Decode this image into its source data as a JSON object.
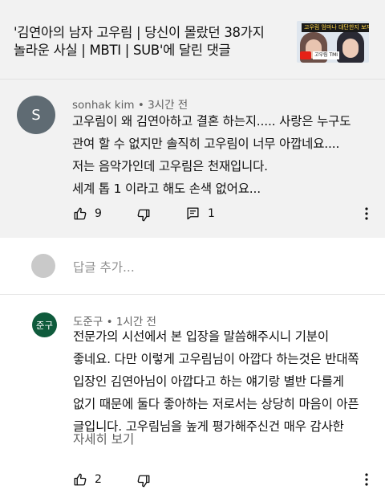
{
  "video": {
    "title_line1": "'김연아의 남자 고우림 | 당신이 몰랐던 38가지",
    "title_line2": "놀라운 사실 | MBTI | SUB'에 달린 댓글",
    "thumbnail": {
      "banner_text": "고우림 엄마나 대단한지 보자",
      "tag_text": "고우림 TMI"
    }
  },
  "comments": [
    {
      "avatar_letter": "S",
      "author": "sonhak kim",
      "separator": "•",
      "time": "3시간 전",
      "lines": [
        "고우림이 왜 김연아하고 결혼 하는지..... 사랑은 누구도",
        "관여 할 수 없지만 솔직히 고우림이 너무 아깝네요....",
        "저는 음악가인데 고우림은 천재입니다.",
        "세계 톱 1 이라고 해도 손색 없어요..."
      ],
      "likes": "9",
      "replies": "1"
    },
    {
      "avatar_letter": "준구",
      "author": "도준구",
      "separator": "•",
      "time": "1시간 전",
      "lines": [
        "전문가의 시선에서 본 입장을 말씀해주시니 기분이",
        "좋네요. 다만 이렇게 고우림님이 아깝다 하는것은 반대쪽",
        "입장인 김연아님이 아깝다고 하는 얘기랑 별반 다를게",
        "없기 때문에 둘다 좋아하는 저로서는 상당히 마음이 아픈",
        "글입니다. 고우림님을 높게 평가해주신건 매우 감사한"
      ],
      "read_more": "자세히 보기",
      "likes": "2"
    }
  ],
  "reply_box": {
    "placeholder": "답글 추가..."
  },
  "icons": {
    "like": "thumbs-up-icon",
    "dislike": "thumbs-down-icon",
    "reply": "comment-reply-icon",
    "more": "more-vertical-icon"
  },
  "colors": {
    "top_panel_bg": "#f2f2f2",
    "meta_text": "#606060",
    "avatar_s": "#5f6b73",
    "avatar_dj": "#0f5b3c"
  }
}
